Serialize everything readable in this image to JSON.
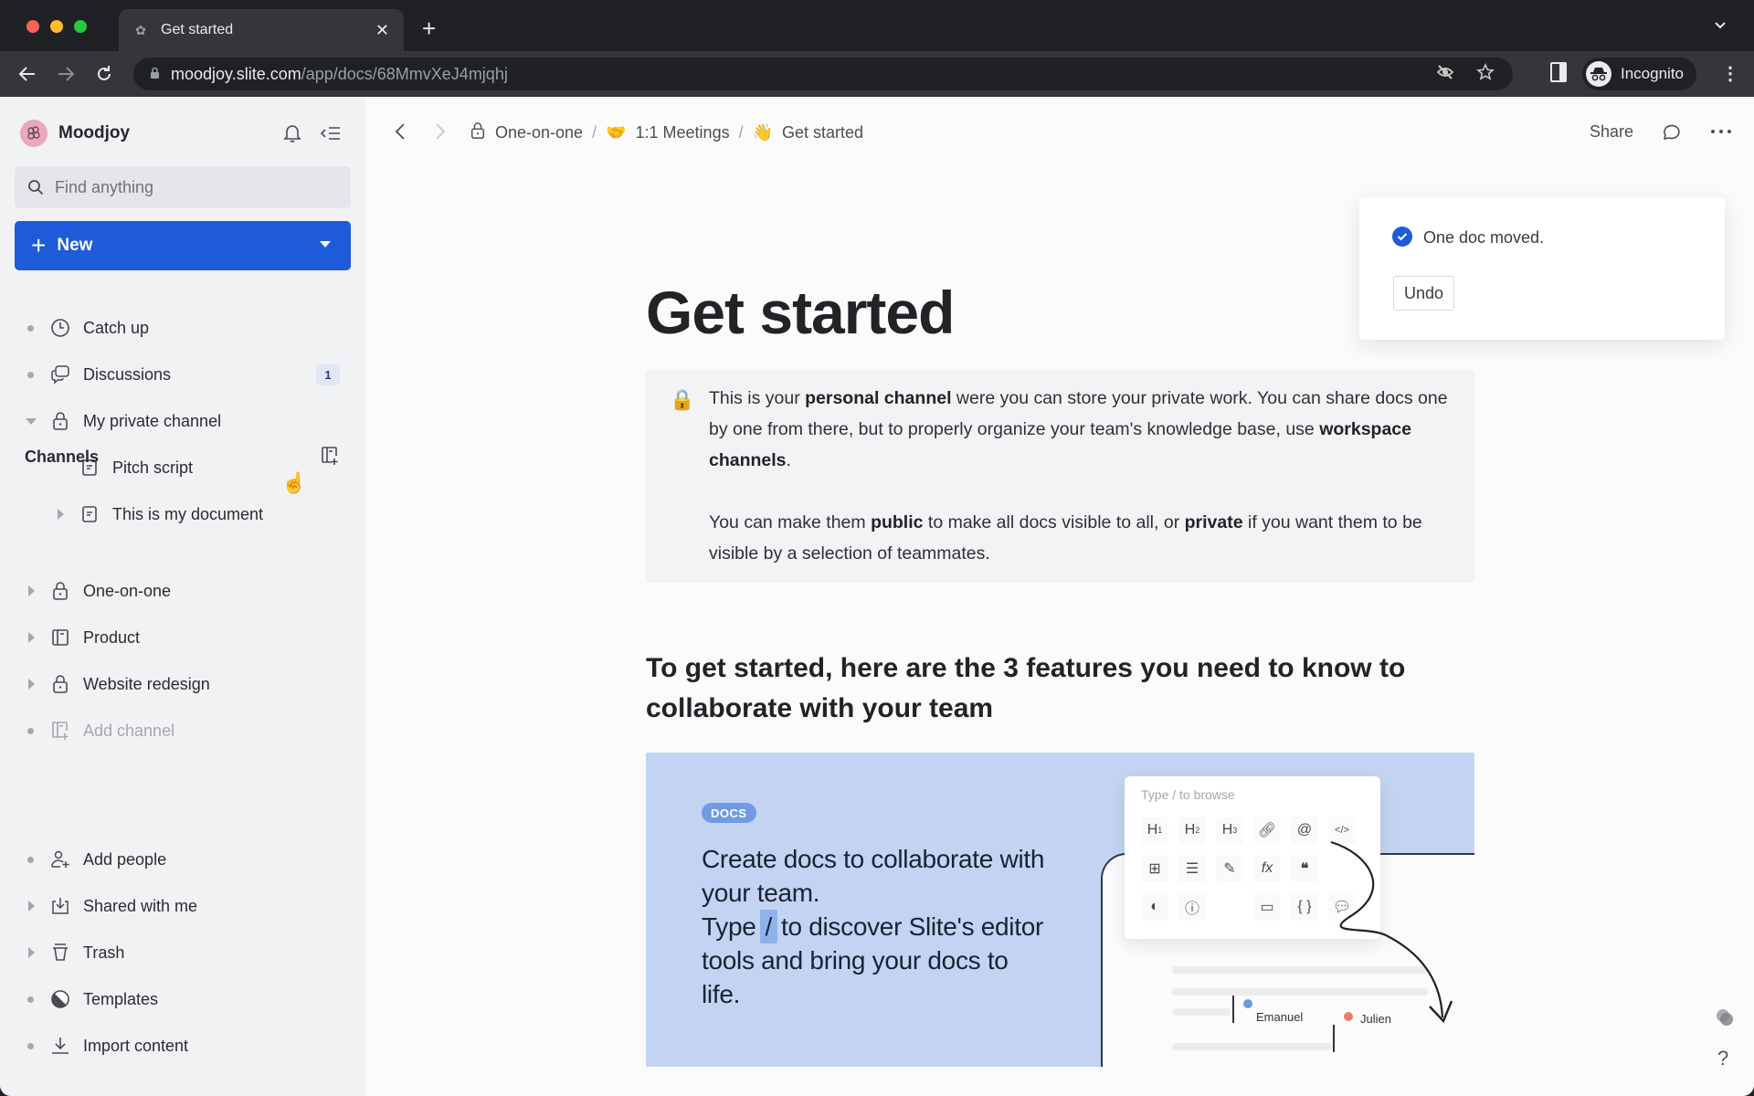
{
  "browser": {
    "tab_title": "Get started",
    "url_host": "moodjoy.slite.com",
    "url_path": "/app/docs/68MmvXeJ4mjqhj",
    "profile_label": "Incognito"
  },
  "sidebar": {
    "workspace_name": "Moodjoy",
    "search_placeholder": "Find anything",
    "new_button_label": "New",
    "top_items": [
      {
        "label": "Catch up",
        "icon": "clock-icon"
      },
      {
        "label": "Discussions",
        "icon": "chat-bubbles-icon",
        "badge": "1"
      },
      {
        "label": "My private channel",
        "icon": "lock-icon",
        "expanded": true
      }
    ],
    "private_children": [
      {
        "label": "Pitch script",
        "icon": "document-icon"
      },
      {
        "label": "This is my document",
        "icon": "document-icon"
      }
    ],
    "channels_title": "Channels",
    "channels": [
      {
        "label": "One-on-one",
        "icon": "lock-icon"
      },
      {
        "label": "Product",
        "icon": "channel-icon"
      },
      {
        "label": "Website redesign",
        "icon": "lock-icon"
      },
      {
        "label": "Add channel",
        "icon": "add-channel-icon"
      }
    ],
    "bottom_items": [
      {
        "label": "Add people",
        "icon": "add-person-icon"
      },
      {
        "label": "Shared with me",
        "icon": "inbox-download-icon"
      },
      {
        "label": "Trash",
        "icon": "trash-icon"
      },
      {
        "label": "Templates",
        "icon": "templates-icon"
      },
      {
        "label": "Import content",
        "icon": "import-icon"
      }
    ]
  },
  "topbar": {
    "breadcrumbs": [
      {
        "label": "One-on-one",
        "icon": "lock-icon"
      },
      {
        "label": "1:1 Meetings",
        "emoji": "🤝"
      },
      {
        "label": "Get started",
        "emoji": "👋"
      }
    ],
    "separator": "/",
    "share_label": "Share"
  },
  "doc": {
    "title": "Get started",
    "callout_emoji": "🔒",
    "callout_p1": {
      "a": "This is your ",
      "b1": "personal channel",
      "c": " were you can store your private work.  You can share docs one by one from there, but to properly organize your team's knowledge base, use ",
      "b2": "workspace channels",
      "d": "."
    },
    "callout_p2": {
      "a": "You can make them ",
      "b1": "public",
      "c": " to make all docs visible to all, or ",
      "b2": "private",
      "d": " if you want them to be visible by a selection of teammates."
    },
    "heading": "To get started, here are the 3 features you need to know to collaborate with your team",
    "feature": {
      "chip": "DOCS",
      "line1": "Create docs to collaborate with your team.",
      "line2a": "Type",
      "slash": "/",
      "line2b": "to discover Slite's editor tools and bring your docs to life.",
      "menu_placeholder": "Type / to browse",
      "users": [
        "Emanuel",
        "Julien"
      ],
      "user_colors": [
        "#6b9be8",
        "#ee7b68"
      ]
    }
  },
  "toast": {
    "message": "One doc moved.",
    "undo_label": "Undo"
  },
  "colors": {
    "accent": "#1d5bd8",
    "sidebar_bg": "#f1f2f4",
    "feature_bg": "#c3d4f2"
  }
}
